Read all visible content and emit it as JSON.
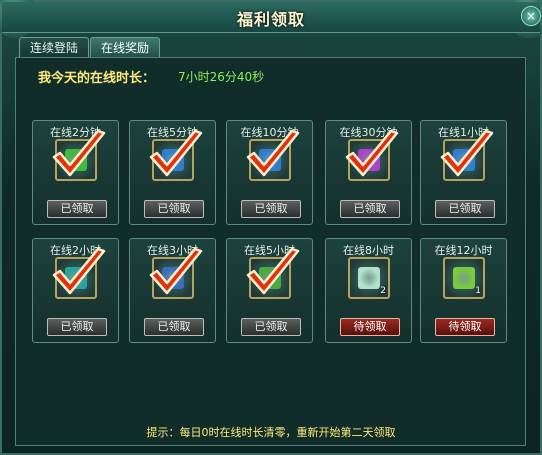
{
  "window": {
    "title": "福利领取",
    "close_glyph": "×"
  },
  "tabs": [
    {
      "label": "连续登陆",
      "active": false
    },
    {
      "label": "在线奖励",
      "active": true
    }
  ],
  "online": {
    "label": "我今天的在线时长：",
    "value": "7小时26分40秒"
  },
  "rewards": [
    {
      "label": "在线2分钟",
      "status": "已领取",
      "claimed": true,
      "icon": "green-gem-icon"
    },
    {
      "label": "在线5分钟",
      "status": "已领取",
      "claimed": true,
      "icon": "blue-gem-icon"
    },
    {
      "label": "在线10分钟",
      "status": "已领取",
      "claimed": true,
      "icon": "blue-gem-icon"
    },
    {
      "label": "在线30分钟",
      "status": "已领取",
      "claimed": true,
      "icon": "purple-gem-icon"
    },
    {
      "label": "在线1小时",
      "status": "已领取",
      "claimed": true,
      "icon": "blue-gem-icon"
    },
    {
      "label": "在线2小时",
      "status": "已领取",
      "claimed": true,
      "icon": "teal-item-icon"
    },
    {
      "label": "在线3小时",
      "status": "已领取",
      "claimed": true,
      "icon": "blue-item-icon"
    },
    {
      "label": "在线5小时",
      "status": "已领取",
      "claimed": true,
      "icon": "green-item-icon"
    },
    {
      "label": "在线8小时",
      "status": "待领取",
      "claimed": false,
      "icon": "scroll-bundle-icon",
      "qty": "2"
    },
    {
      "label": "在线12小时",
      "status": "待领取",
      "claimed": false,
      "icon": "cash-bundle-icon",
      "qty": "1"
    }
  ],
  "hint": "提示：每日0时在线时长清零，重新开始第二天领取",
  "colors": {
    "highlight_text": "#ffe97a",
    "time_value": "#8cf05a",
    "check_red": "#e0320f",
    "pending_button": "#9b2a22"
  }
}
